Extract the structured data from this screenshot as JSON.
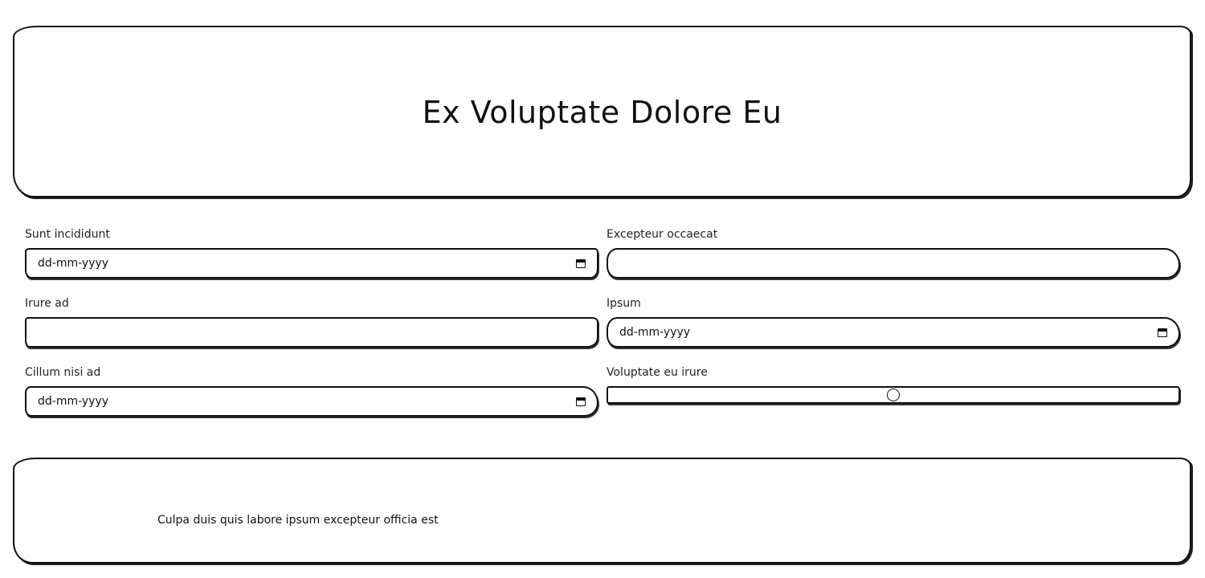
{
  "header": {
    "title": "Ex Voluptate Dolore Eu"
  },
  "form": {
    "fields": [
      {
        "label": "Sunt incididunt",
        "type": "date",
        "placeholder": "dd-mm-yyyy"
      },
      {
        "label": "Excepteur occaecat",
        "type": "text",
        "value": ""
      },
      {
        "label": "Irure ad",
        "type": "text",
        "value": ""
      },
      {
        "label": "Ipsum",
        "type": "date",
        "placeholder": "dd-mm-yyyy"
      },
      {
        "label": "Cillum nisi ad",
        "type": "date",
        "placeholder": "dd-mm-yyyy"
      },
      {
        "label": "Voluptate eu irure",
        "type": "range",
        "value": 0.5
      }
    ]
  },
  "footer": {
    "text": "Culpa duis quis labore ipsum excepteur officia est"
  },
  "icons": {
    "date_picker": "calendar-icon"
  }
}
